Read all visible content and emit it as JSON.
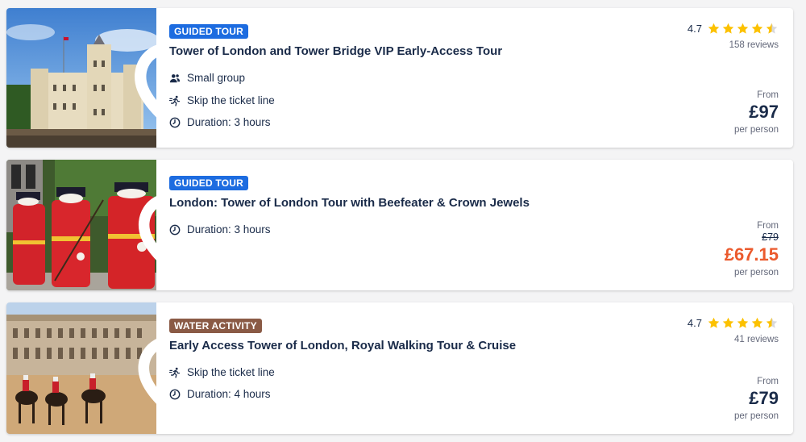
{
  "colors": {
    "badge_guided": "#1d6ce0",
    "badge_water": "#8a5a45",
    "star": "#fcc100",
    "sale_price": "#eb5a2d",
    "text": "#1a2b49"
  },
  "cards": [
    {
      "badge": "GUIDED TOUR",
      "title": "Tower of London and Tower Bridge VIP Early-Access Tour",
      "features": [
        {
          "icon": "group-icon",
          "label": "Small group"
        },
        {
          "icon": "skip-line-icon",
          "label": "Skip the ticket line"
        },
        {
          "icon": "clock-icon",
          "label": "Duration: 3 hours"
        }
      ],
      "rating": "4.7",
      "reviews": "158 reviews",
      "stars": 4.5,
      "price_from": "From",
      "price": "£97",
      "per": "per person",
      "image": "tower-of-london-photo",
      "favorite_icon": "heart-outline-icon"
    },
    {
      "badge": "GUIDED TOUR",
      "title": "London: Tower of London Tour with Beefeater & Crown Jewels",
      "features": [
        {
          "icon": "clock-icon",
          "label": "Duration: 3 hours"
        }
      ],
      "price_from": "From",
      "old_price": "£79",
      "price": "£67.15",
      "per": "per person",
      "image": "beefeater-guards-photo",
      "favorite_icon": "heart-outline-icon"
    },
    {
      "badge": "WATER ACTIVITY",
      "title": "Early Access Tower of London, Royal Walking Tour & Cruise",
      "features": [
        {
          "icon": "skip-line-icon",
          "label": "Skip the ticket line"
        },
        {
          "icon": "clock-icon",
          "label": "Duration: 4 hours"
        }
      ],
      "rating": "4.7",
      "reviews": "41 reviews",
      "stars": 4.5,
      "price_from": "From",
      "price": "£79",
      "per": "per person",
      "image": "horse-guards-parade-photo",
      "favorite_icon": "heart-outline-icon"
    }
  ]
}
